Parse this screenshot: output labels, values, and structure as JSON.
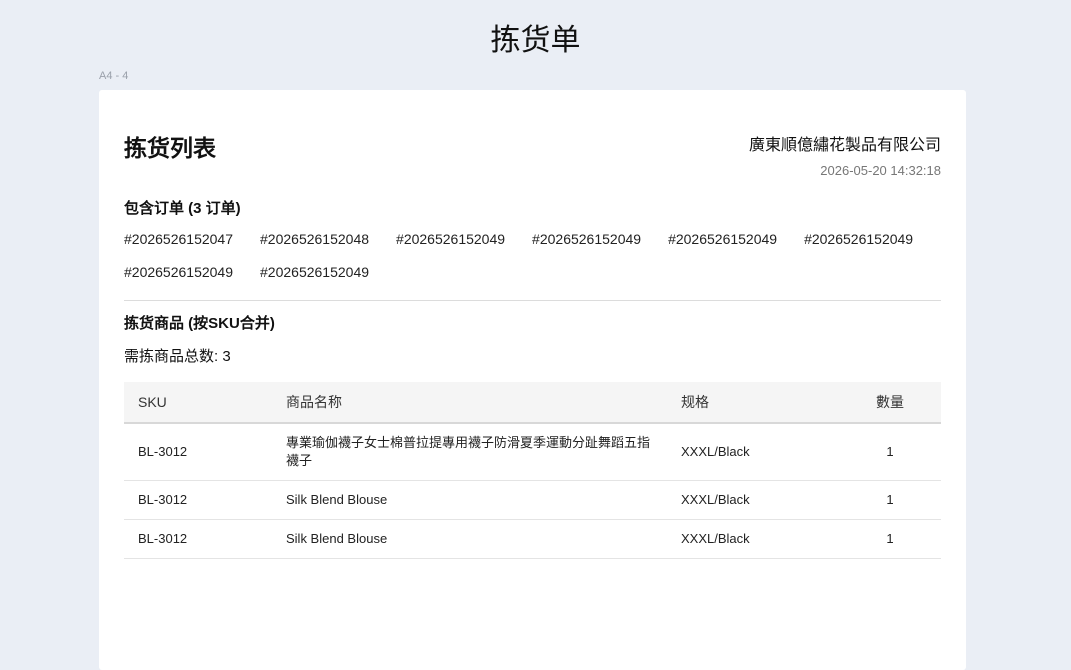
{
  "header": {
    "title": "拣货单",
    "page_size": "A4 - 4"
  },
  "document": {
    "title": "拣货列表",
    "company": "廣東順億繡花製品有限公司",
    "print_time": "2026-05-20 14:32:18"
  },
  "orders": {
    "section_title": "包含订单 (3 订单)",
    "ids": [
      "#2026526152047",
      "#2026526152048",
      "#2026526152049",
      "#2026526152049",
      "#2026526152049",
      "#2026526152049",
      "#2026526152049",
      "#2026526152049"
    ]
  },
  "items": {
    "section_title": "拣货商品 (按SKU合并)",
    "total_line": "需拣商品总数: 3",
    "columns": {
      "sku": "SKU",
      "name": "商品名称",
      "spec": "规格",
      "qty": "數量"
    },
    "rows": [
      {
        "sku": "BL-3012",
        "name": "專業瑜伽襪子女士棉普拉提專用襪子防滑夏季運動分趾舞蹈五指襪子",
        "spec": "XXXL/Black",
        "qty": "1"
      },
      {
        "sku": "BL-3012",
        "name": "Silk Blend Blouse",
        "spec": "XXXL/Black",
        "qty": "1"
      },
      {
        "sku": "BL-3012",
        "name": "Silk Blend Blouse",
        "spec": "XXXL/Black",
        "qty": "1"
      }
    ]
  }
}
